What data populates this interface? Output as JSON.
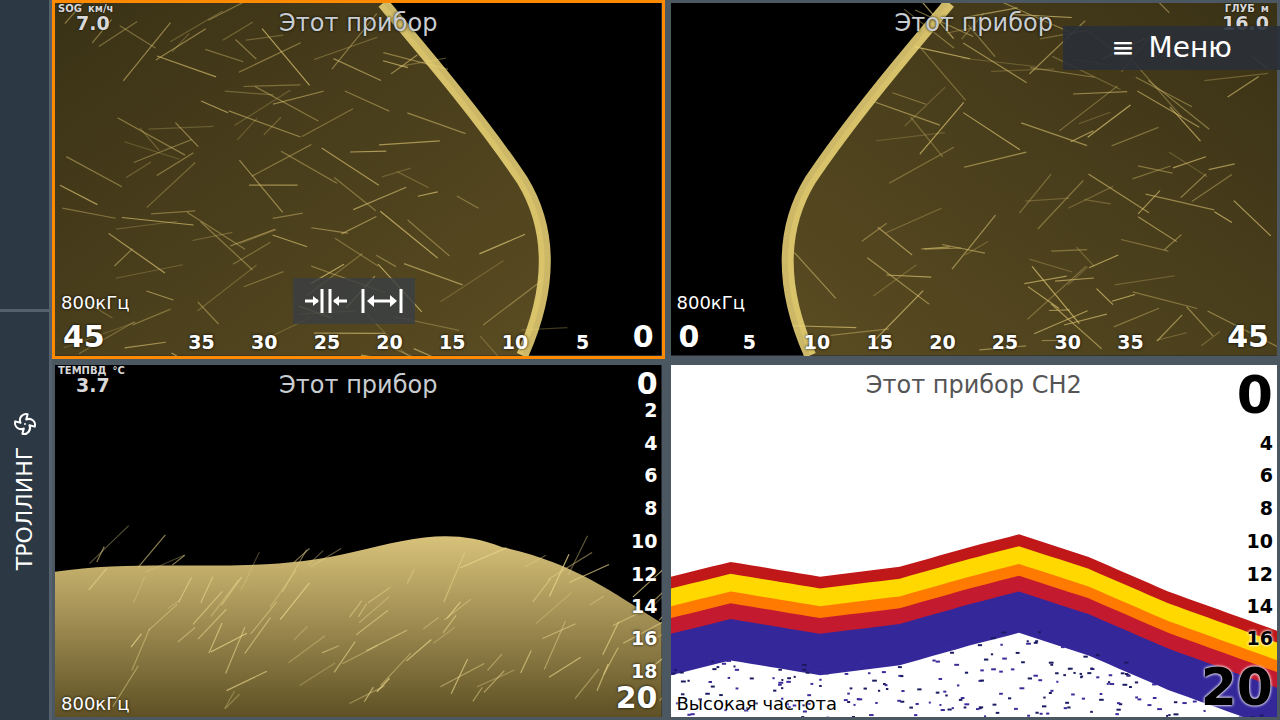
{
  "sidebar": {
    "mode": "ТРОЛЛИНГ"
  },
  "menu_button": {
    "icon": "≡",
    "label": "Меню"
  },
  "panels": [
    {
      "kind": "side-left",
      "selected": true,
      "title": "Этот прибор",
      "frequency": "800кГц",
      "readout": {
        "label": "SOG",
        "unit": "км/ч",
        "value": "7.0"
      },
      "range_ticks": [
        "45",
        "35",
        "30",
        "25",
        "20",
        "15",
        "10",
        "5",
        "0"
      ],
      "zoom_controls": true
    },
    {
      "kind": "side-right",
      "selected": false,
      "title": "Этот прибор",
      "frequency": "800кГц",
      "readout": {
        "label": "ГЛУБ",
        "unit": "м",
        "value": "16.0"
      },
      "range_ticks": [
        "0",
        "5",
        "10",
        "15",
        "20",
        "25",
        "30",
        "35",
        "45"
      ],
      "zoom_controls": false
    },
    {
      "kind": "down",
      "selected": false,
      "title": "Этот прибор",
      "frequency": "800кГц",
      "readout": {
        "label": "ТЕМПВД",
        "unit": "°C",
        "value": "3.7"
      },
      "depth_ticks": [
        "0",
        "2",
        "4",
        "6",
        "8",
        "10",
        "12",
        "14",
        "16",
        "18",
        "20"
      ],
      "zoom_controls": false
    },
    {
      "kind": "2d",
      "selected": false,
      "title": "Этот прибор CH2",
      "frequency": "Высокая частота",
      "depth_ticks": [
        "0",
        "4",
        "6",
        "8",
        "10",
        "12",
        "14",
        "16",
        "20"
      ],
      "zoom_controls": false
    }
  ]
}
